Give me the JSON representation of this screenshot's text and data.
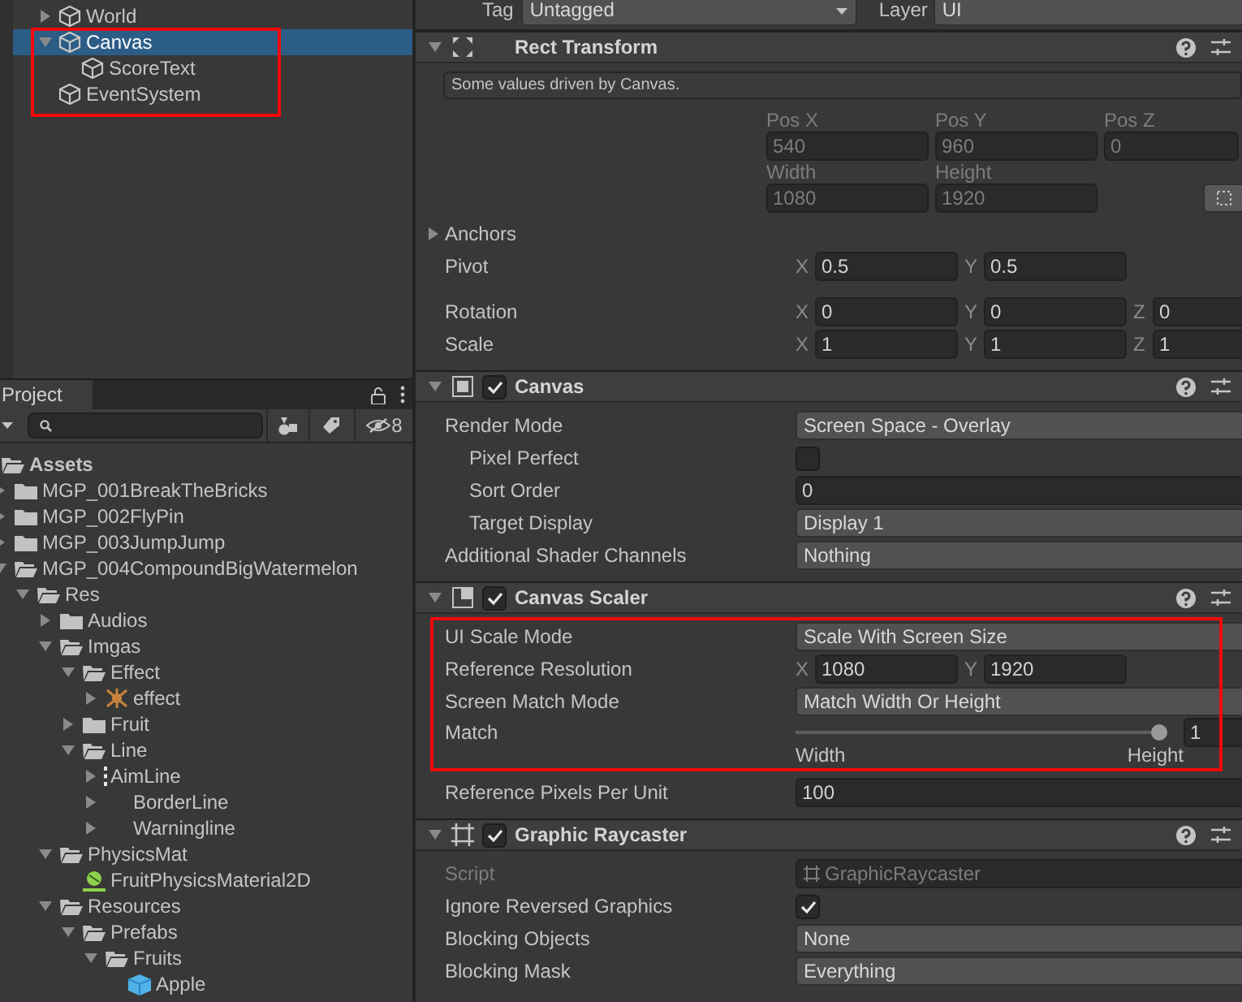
{
  "hierarchy": {
    "items": [
      {
        "label": "World",
        "expanded": false,
        "selected": false,
        "marked": false
      },
      {
        "label": "Canvas",
        "expanded": true,
        "selected": true,
        "marked": true,
        "children": [
          {
            "label": "ScoreText",
            "selected": false
          }
        ]
      },
      {
        "label": "EventSystem",
        "selected": false,
        "marked": true
      }
    ]
  },
  "project": {
    "tab": "Project",
    "hidden_count": "8",
    "tree": [
      {
        "label": "Assets",
        "kind": "folder",
        "expanded": true,
        "children": [
          {
            "label": "MGP_001BreakTheBricks",
            "kind": "folder",
            "expanded": false
          },
          {
            "label": "MGP_002FlyPin",
            "kind": "folder",
            "expanded": false
          },
          {
            "label": "MGP_003JumpJump",
            "kind": "folder",
            "expanded": false
          },
          {
            "label": "MGP_004CompoundBigWatermelon",
            "kind": "folder",
            "expanded": true,
            "children": [
              {
                "label": "Res",
                "kind": "folder",
                "expanded": true,
                "children": [
                  {
                    "label": "Audios",
                    "kind": "folder",
                    "expanded": false
                  },
                  {
                    "label": "Imgas",
                    "kind": "folder",
                    "expanded": true,
                    "children": [
                      {
                        "label": "Effect",
                        "kind": "folder",
                        "expanded": true,
                        "children": [
                          {
                            "label": "effect",
                            "kind": "effect",
                            "expanded": false
                          }
                        ]
                      },
                      {
                        "label": "Fruit",
                        "kind": "folder",
                        "expanded": false
                      },
                      {
                        "label": "Line",
                        "kind": "folder",
                        "expanded": true,
                        "children": [
                          {
                            "label": "AimLine",
                            "kind": "line",
                            "expanded": false
                          },
                          {
                            "label": "BorderLine",
                            "kind": "blank",
                            "expanded": false
                          },
                          {
                            "label": "Warningline",
                            "kind": "blank",
                            "expanded": false
                          }
                        ]
                      }
                    ]
                  },
                  {
                    "label": "PhysicsMat",
                    "kind": "folder",
                    "expanded": true,
                    "children": [
                      {
                        "label": "FruitPhysicsMaterial2D",
                        "kind": "physics_material"
                      }
                    ]
                  },
                  {
                    "label": "Resources",
                    "kind": "folder",
                    "expanded": true,
                    "children": [
                      {
                        "label": "Prefabs",
                        "kind": "folder",
                        "expanded": true,
                        "children": [
                          {
                            "label": "Fruits",
                            "kind": "folder",
                            "expanded": true,
                            "children": [
                              {
                                "label": "Apple",
                                "kind": "prefab"
                              }
                            ]
                          }
                        ]
                      }
                    ]
                  }
                ]
              }
            ]
          }
        ]
      }
    ]
  },
  "inspector": {
    "tag": {
      "label": "Tag",
      "value": "Untagged"
    },
    "layer": {
      "label": "Layer",
      "value": "UI"
    },
    "components": [
      {
        "kind": "rect_transform",
        "title": "Rect Transform",
        "expanded": true,
        "driven": true,
        "note": "Some values driven by Canvas.",
        "driven_fields": [
          {
            "label": "Pos X",
            "value": "540"
          },
          {
            "label": "Pos Y",
            "value": "960"
          },
          {
            "label": "Pos Z",
            "value": "0"
          },
          {
            "label": "Width",
            "value": "1080"
          },
          {
            "label": "Height",
            "value": "1920"
          }
        ],
        "properties": [
          {
            "kind": "foldout",
            "label": "Anchors",
            "expanded": false
          },
          {
            "kind": "vector",
            "label": "Pivot",
            "values": [
              {
                "axis": "X",
                "value": "0.5"
              },
              {
                "axis": "Y",
                "value": "0.5"
              }
            ]
          },
          {
            "kind": "vector",
            "label": "Rotation",
            "values": [
              {
                "axis": "X",
                "value": "0"
              },
              {
                "axis": "Y",
                "value": "0"
              },
              {
                "axis": "Z",
                "value": "0"
              }
            ]
          },
          {
            "kind": "vector",
            "label": "Scale",
            "values": [
              {
                "axis": "X",
                "value": "1"
              },
              {
                "axis": "Y",
                "value": "1"
              },
              {
                "axis": "Z",
                "value": "1"
              }
            ]
          }
        ]
      },
      {
        "kind": "canvas",
        "title": "Canvas",
        "expanded": true,
        "enabled": true,
        "properties": [
          {
            "kind": "dropdown",
            "label": "Render Mode",
            "value": "Screen Space - Overlay",
            "children": [
              {
                "kind": "checkbox",
                "label": "Pixel Perfect",
                "checked": false
              },
              {
                "kind": "number",
                "label": "Sort Order",
                "value": "0"
              },
              {
                "kind": "dropdown",
                "label": "Target Display",
                "value": "Display 1"
              }
            ]
          },
          {
            "kind": "dropdown",
            "label": "Additional Shader Channels",
            "value": "Nothing"
          }
        ]
      },
      {
        "kind": "canvas_scaler",
        "title": "Canvas Scaler",
        "expanded": true,
        "enabled": true,
        "properties": [
          {
            "kind": "dropdown",
            "label": "UI Scale Mode",
            "value": "Scale With Screen Size",
            "marked": true
          },
          {
            "kind": "vector",
            "label": "Reference Resolution",
            "values": [
              {
                "axis": "X",
                "value": "1080"
              },
              {
                "axis": "Y",
                "value": "1920"
              }
            ],
            "marked": true
          },
          {
            "kind": "dropdown",
            "label": "Screen Match Mode",
            "value": "Match Width Or Height",
            "marked": true
          },
          {
            "kind": "slider",
            "label": "Match",
            "level": 1,
            "value": "1",
            "min_label": "Width",
            "max_label": "Height",
            "marked": true
          },
          {
            "kind": "number",
            "label": "Reference Pixels Per Unit",
            "value": "100"
          }
        ]
      },
      {
        "kind": "graphic_raycaster",
        "title": "Graphic Raycaster",
        "expanded": true,
        "enabled": true,
        "properties": [
          {
            "kind": "object",
            "label": "Script",
            "value": "GraphicRaycaster",
            "disabled": true
          },
          {
            "kind": "checkbox",
            "label": "Ignore Reversed Graphics",
            "checked": true
          },
          {
            "kind": "dropdown",
            "label": "Blocking Objects",
            "value": "None"
          },
          {
            "kind": "dropdown",
            "label": "Blocking Mask",
            "value": "Everything"
          }
        ]
      }
    ]
  }
}
